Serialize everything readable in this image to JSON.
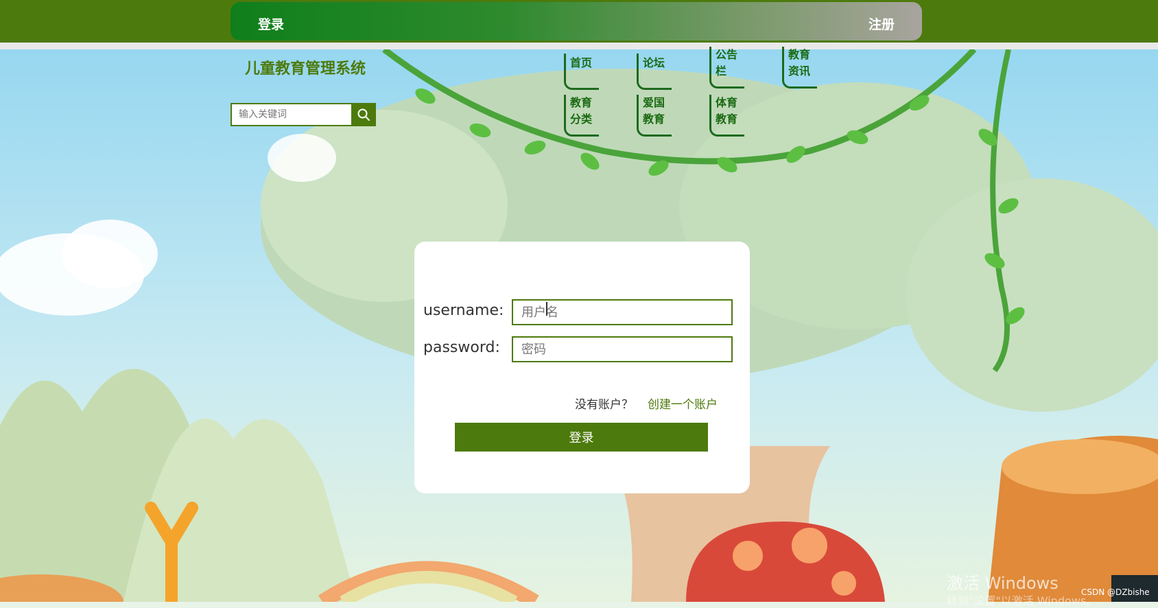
{
  "header": {
    "login_label": "登录",
    "register_label": "注册"
  },
  "brand": {
    "title": "儿童教育管理系统"
  },
  "search": {
    "placeholder": "输入关键词"
  },
  "nav": {
    "items": [
      {
        "label": "首页"
      },
      {
        "label": "论坛"
      },
      {
        "label": "公告栏"
      },
      {
        "label": "教育资讯"
      },
      {
        "label": "教育分类"
      },
      {
        "label": "爱国教育"
      },
      {
        "label": "体育教育"
      }
    ]
  },
  "login_form": {
    "username_label": "username:",
    "username_placeholder": "用户名",
    "password_label": "password:",
    "password_placeholder": "密码",
    "no_account_text": "没有账户？",
    "create_account_link": "创建一个账户",
    "submit_label": "登录"
  },
  "watermark": {
    "windows_activate": "激活 Windows",
    "windows_activate_sub": "转到\"设置\"以激活 Windows。",
    "csdn": "CSDN @DZbishe"
  },
  "colors": {
    "brand_green": "#4d7a0c",
    "nav_green": "#1a6a12"
  }
}
